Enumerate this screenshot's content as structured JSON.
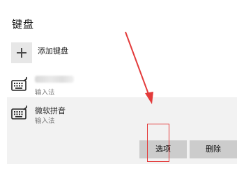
{
  "section": {
    "title": "键盘"
  },
  "add_keyboard": {
    "label": "添加键盘",
    "icon": "plus-icon"
  },
  "keyboards": [
    {
      "name": "",
      "subtitle": "输入法",
      "icon": "keyboard-icon"
    },
    {
      "name": "微软拼音",
      "subtitle": "输入法",
      "icon": "keyboard-icon",
      "selected": true
    }
  ],
  "buttons": {
    "options_label": "选项",
    "delete_label": "删除"
  },
  "annotation": {
    "arrow_color": "#e33b3b",
    "box_color": "#e33b3b"
  }
}
